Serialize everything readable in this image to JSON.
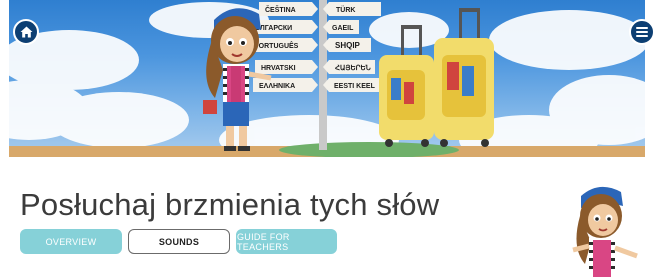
{
  "header": {
    "home_icon": "home-icon",
    "menu_icon": "hamburger-menu-icon"
  },
  "banner": {
    "signposts": [
      "ČEŠTINA",
      "TÜRK",
      "БЪЛГАРСКИ",
      "GAEIL",
      "PORTUGUÊS",
      "SHQIP",
      "HRVATSKI",
      "ՀԱՅԵՐԵՆ",
      "ΕΛΛΗΝΙΚΑ",
      "EESTI KEEL"
    ]
  },
  "main": {
    "title": "Posłuchaj brzmienia tych słów",
    "tabs": [
      {
        "label": "OVERVIEW",
        "active": false
      },
      {
        "label": "SOUNDS",
        "active": true
      },
      {
        "label": "GUIDE FOR TEACHERS",
        "active": false
      }
    ]
  },
  "colors": {
    "tab_teal": "#86d1d8",
    "nav_button": "#0d3f73",
    "title_text": "#3b3b3b"
  }
}
